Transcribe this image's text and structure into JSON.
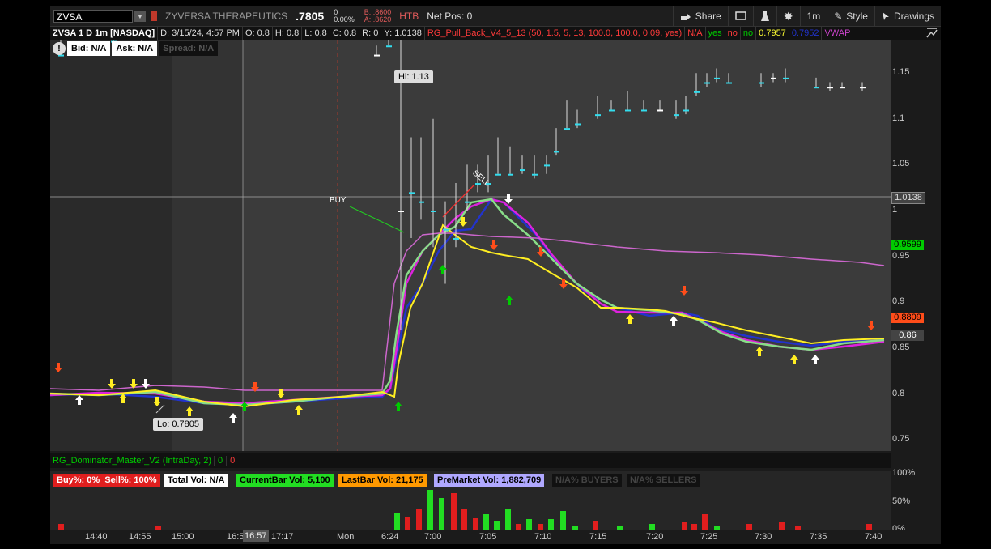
{
  "toolbar": {
    "symbol": "ZVSA",
    "company": "ZYVERSA THERAPEUTICS",
    "last": ".7805",
    "change_top": "0",
    "change_bottom": "0.00%",
    "bid": "B: .8600",
    "ask": "A: .8620",
    "htb": "HTB",
    "net_pos": "Net Pos: 0",
    "share": "Share",
    "timeframe": "1m",
    "style": "Style",
    "drawings": "Drawings"
  },
  "studyline": {
    "desc": "ZVSA 1 D 1m [NASDAQ]",
    "date": "D: 3/15/24, 4:57 PM",
    "open": "O: 0.8",
    "high": "H: 0.8",
    "low": "L: 0.8",
    "close": "C: 0.8",
    "r": "R: 0",
    "y": "Y: 1.0138",
    "study": "RG_Pull_Back_V4_5_13 (50, 1.5, 5, 13, 100.0, 100.0, 0.09, yes)",
    "na": "N/A",
    "yes1": "yes",
    "no1": "no",
    "no2": "no",
    "val1": "0.7957",
    "val2": "0.7952",
    "vwap": "VWAP"
  },
  "bidask": {
    "bid": "Bid: N/A",
    "ask": "Ask: N/A",
    "spread": "Spread: N/A"
  },
  "annotations": {
    "hi": "Hi: 1.13",
    "lo": "Lo: 0.7805",
    "buy": "BUY",
    "sell": "SELL"
  },
  "price_axis": {
    "ticks": [
      "1.15",
      "1.1",
      "1.05",
      "1",
      "0.95",
      "0.9",
      "0.85",
      "0.8",
      "0.75"
    ],
    "crosshair_label": "1.0138",
    "vwap_label": "0.9599",
    "last_label": "0.8809",
    "current_label": "0.86",
    "colors": {
      "vwap": "#00cc00",
      "last": "#ff4d1a",
      "current": "#444444"
    }
  },
  "lower": {
    "title": "RG_Dominator_Master_V2 (IntraDay, 2)",
    "v1": "0",
    "v2": "0",
    "buy_pct": "Buy%: 0%",
    "sell_pct": "Sell%: 100%",
    "total_vol": "Total Vol: N/A",
    "current_bar": "CurrentBar Vol: 5,100",
    "last_bar": "LastBar Vol: 21,175",
    "premarket": "PreMarket Vol: 1,882,709",
    "buyers": "N/A% BUYERS",
    "sellers": "N/A% SELLERS",
    "axis": [
      "100%",
      "50%",
      "0%"
    ]
  },
  "time_axis": {
    "labels": [
      "14:40",
      "14:55",
      "15:00",
      "16:5",
      "16:57",
      "17:17",
      "Mon",
      "6:24",
      "7:00",
      "7:05",
      "7:10",
      "7:15",
      "7:20",
      "7:25",
      "7:30",
      "7:35",
      "7:40"
    ]
  }
}
